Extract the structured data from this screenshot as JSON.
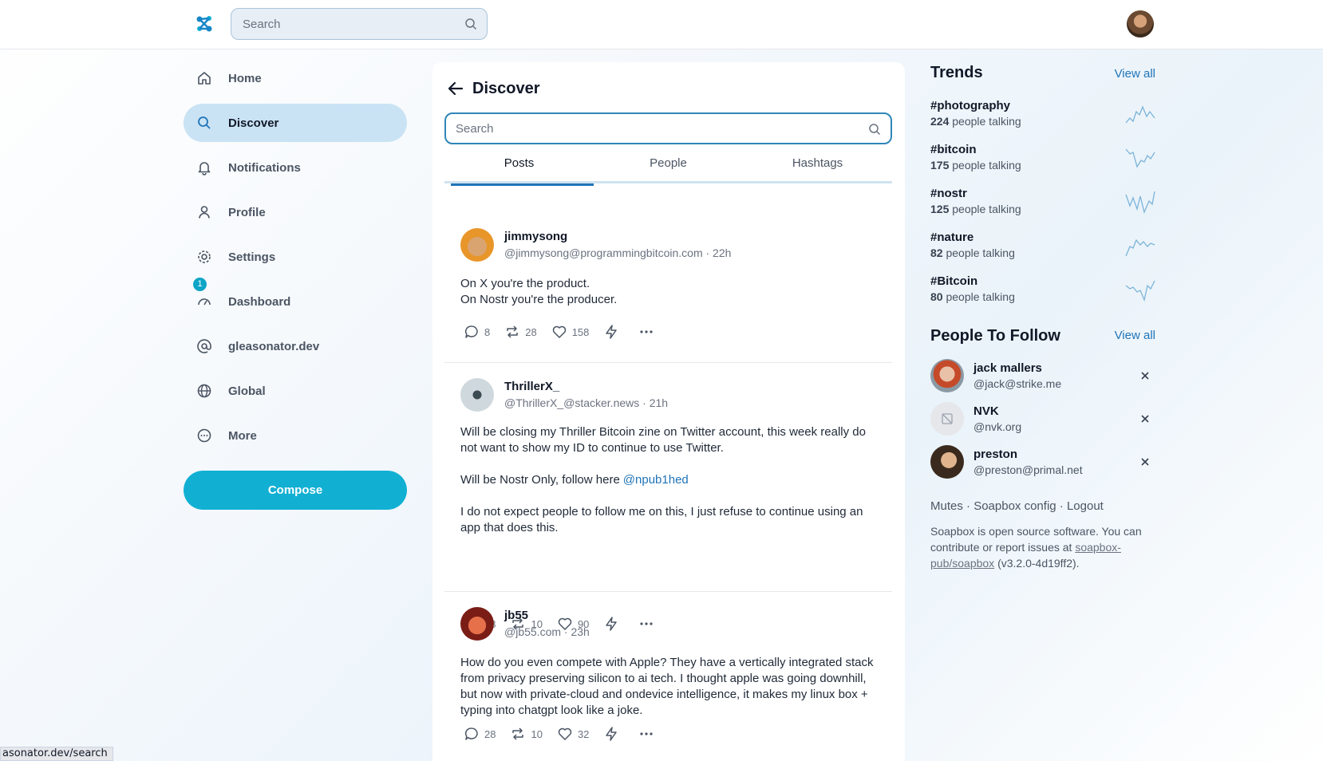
{
  "header": {
    "search_placeholder": "Search"
  },
  "sidebar": {
    "items": [
      {
        "label": "Home",
        "icon": "home-icon"
      },
      {
        "label": "Discover",
        "icon": "search-icon",
        "active": true
      },
      {
        "label": "Notifications",
        "icon": "bell-icon"
      },
      {
        "label": "Profile",
        "icon": "user-icon"
      },
      {
        "label": "Settings",
        "icon": "gear-icon"
      },
      {
        "label": "Dashboard",
        "icon": "dashboard-icon",
        "badge": "1"
      },
      {
        "label": "gleasonator.dev",
        "icon": "at-icon"
      },
      {
        "label": "Global",
        "icon": "globe-icon"
      },
      {
        "label": "More",
        "icon": "more-circle-icon"
      }
    ],
    "compose_label": "Compose"
  },
  "main": {
    "title": "Discover",
    "search_placeholder": "Search",
    "tabs": [
      {
        "label": "Posts",
        "active": true
      },
      {
        "label": "People"
      },
      {
        "label": "Hashtags"
      }
    ],
    "posts": [
      {
        "name": "jimmysong",
        "handle": "@jimmysong@programmingbitcoin.com · 22h",
        "body": [
          "On X you're the product.",
          "On Nostr you're the producer."
        ],
        "replies": "8",
        "reposts": "28",
        "likes": "158"
      },
      {
        "name": "ThrillerX_",
        "handle": "@ThrillerX_@stacker.news · 21h",
        "body_p1": "Will be closing my Thriller Bitcoin zine on Twitter account, this week really do not want to show my ID to continue to use Twitter.",
        "body_p2": "Will be Nostr Only, follow here",
        "mention": "@npub1hed",
        "body_p3": "I do not expect people to follow me on this, I just refuse to continue using an app that does this.",
        "replies": "28",
        "reposts": "10",
        "likes": "90"
      },
      {
        "name": "jb55",
        "handle": "@jb55.com · 23h",
        "body": "How do you even compete with Apple? They have a vertically integrated stack from privacy preserving silicon to ai tech. I thought apple was going downhill, but now with private-cloud and ondevice intelligence, it makes my linux box + typing into chatgpt look like a joke.",
        "replies": "28",
        "reposts": "10",
        "likes": "32"
      }
    ]
  },
  "trends": {
    "title": "Trends",
    "view_all": "View all",
    "items": [
      {
        "tag": "#photography",
        "count": "224",
        "suffix": "people talking"
      },
      {
        "tag": "#bitcoin",
        "count": "175",
        "suffix": "people talking"
      },
      {
        "tag": "#nostr",
        "count": "125",
        "suffix": "people talking"
      },
      {
        "tag": "#nature",
        "count": "82",
        "suffix": "people talking"
      },
      {
        "tag": "#Bitcoin",
        "count": "80",
        "suffix": "people talking"
      }
    ]
  },
  "follow": {
    "title": "People To Follow",
    "view_all": "View all",
    "people": [
      {
        "name": "jack mallers",
        "handle": "@jack@strike.me"
      },
      {
        "name": "NVK",
        "handle": "@nvk.org"
      },
      {
        "name": "preston",
        "handle": "@preston@primal.net"
      }
    ]
  },
  "footer": {
    "mutes": "Mutes",
    "config": "Soapbox config",
    "logout": "Logout",
    "sep": "·",
    "text": "Soapbox is open source software. You can contribute or report issues at",
    "repo": "soapbox-pub/soapbox",
    "version": "(v3.2.0-4d19ff2)."
  },
  "status_bar": {
    "url": "asonator.dev/search"
  },
  "colors": {
    "accent": "#11b0d3",
    "link": "#1f74b8",
    "active_nav": "#c9e3f4"
  }
}
